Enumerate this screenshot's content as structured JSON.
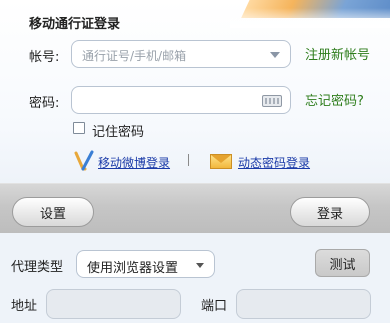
{
  "login": {
    "title": "移动通行证登录",
    "account_label": "帐号:",
    "account_placeholder": "通行证号/手机/邮箱",
    "register_link": "注册新帐号",
    "password_label": "密码:",
    "password_value": "",
    "forgot_link": "忘记密码?",
    "remember_label": "记住密码",
    "remember_checked": false,
    "weibo_login_link": "移动微博登录",
    "separator": "|",
    "dynamic_login_link": "动态密码登录"
  },
  "actions": {
    "settings_label": "设置",
    "login_label": "登录"
  },
  "proxy": {
    "type_label": "代理类型",
    "type_value": "使用浏览器设置",
    "test_label": "测试",
    "address_label": "地址",
    "address_value": "",
    "port_label": "端口",
    "port_value": ""
  },
  "colors": {
    "link_green": "#2e7d1c",
    "link_blue": "#1a3aa8",
    "brand_orange": "#f5b45c",
    "brand_blue": "#5d8cc8"
  },
  "icons": {
    "weibo": "weibo-v-icon",
    "mail": "mail-icon",
    "keyboard": "soft-keyboard-icon",
    "dropdown": "chevron-down-icon"
  }
}
